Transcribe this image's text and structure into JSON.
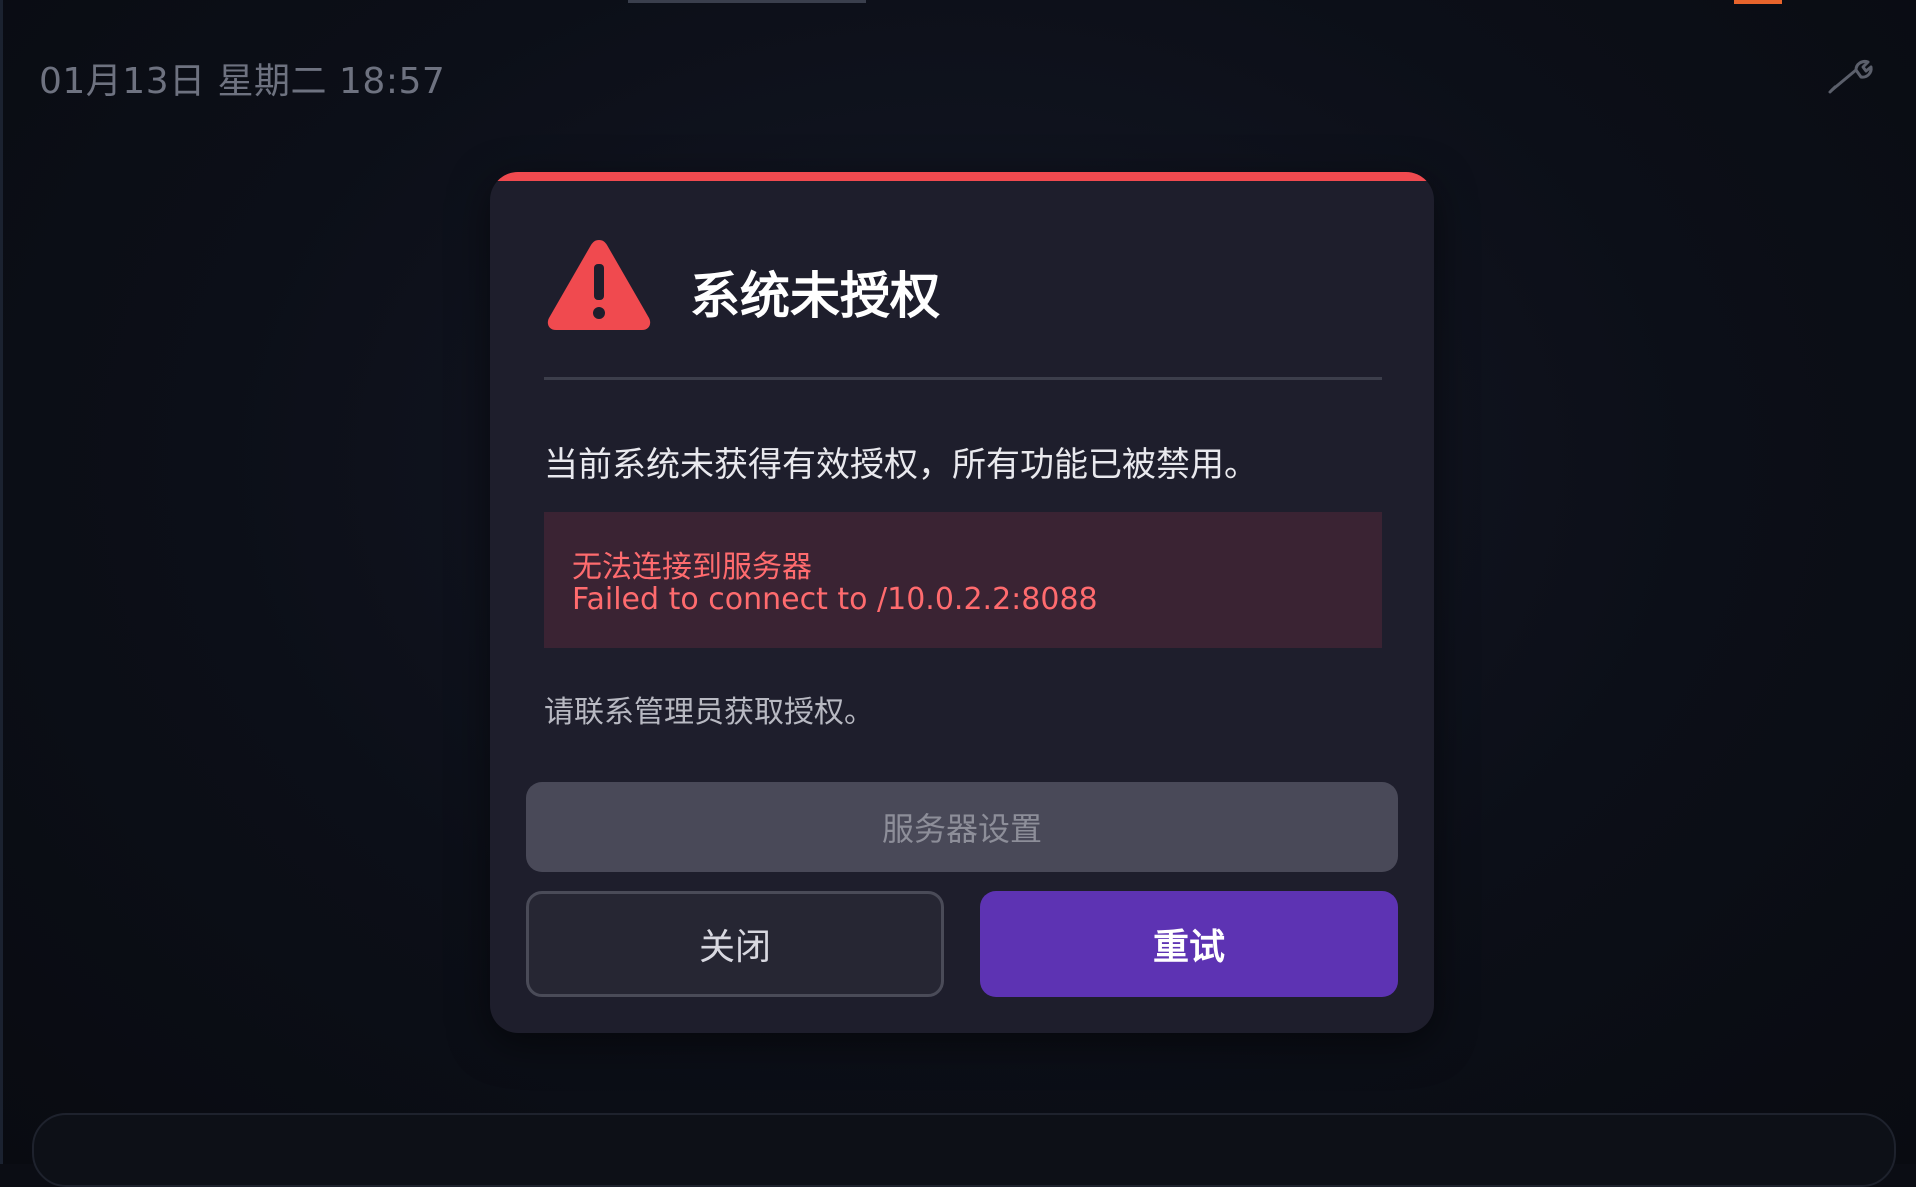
{
  "status_bar": {
    "datetime": "01月13日 星期二 18:57",
    "tool_icon": "wrench-icon"
  },
  "dialog": {
    "title": "系统未授权",
    "warning_icon": "warning-triangle-icon",
    "message": "当前系统未获得有效授权，所有功能已被禁用。",
    "error": {
      "title": "无法连接到服务器",
      "detail": "Failed to connect to /10.0.2.2:8088"
    },
    "hint": "请联系管理员获取授权。",
    "buttons": {
      "server_settings": "服务器设置",
      "close": "关闭",
      "retry": "重试"
    }
  },
  "colors": {
    "accent_red": "#f04a4f",
    "primary_purple": "#5d33b3",
    "error_text": "#ff6b6e",
    "dialog_bg": "#1e1e2c"
  }
}
